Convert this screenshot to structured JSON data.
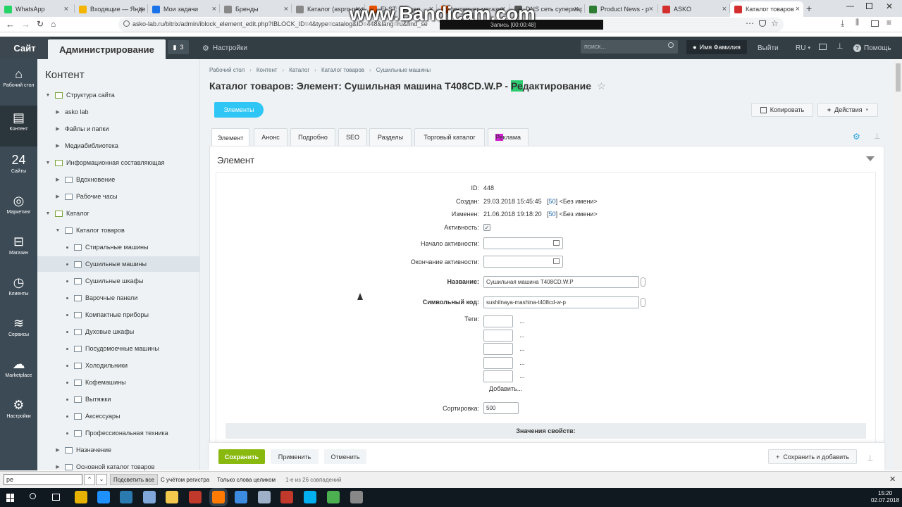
{
  "browser": {
    "tabs": [
      {
        "label": "WhatsApp",
        "color": "#25d366"
      },
      {
        "label": "Входящие — Янде",
        "color": "#f4b400"
      },
      {
        "label": "Мои задачи",
        "color": "#1a73e8"
      },
      {
        "label": "Бренды",
        "color": "#888888"
      },
      {
        "label": "Каталог (aspro.next)",
        "color": "#888888"
      },
      {
        "label": "ELST: Раздел",
        "color": "#e65100"
      },
      {
        "label": "интернет-магазин",
        "color": "#e65100"
      },
      {
        "label": "DNS сеть супермар",
        "color": "#555555"
      },
      {
        "label": "Product News - р",
        "color": "#2e7d32"
      },
      {
        "label": "ASKO",
        "color": "#d32f2f"
      },
      {
        "label": "Каталог товаров",
        "color": "#d32f2f"
      }
    ],
    "url": "asko-lab.ru/bitrix/admin/iblock_element_edit.php?IBLOCK_ID=4&type=catalog&ID=448&lang=ru&find_se"
  },
  "overlay": {
    "watermark": "www.Bandicam.com",
    "rec_label": "Запись [00:00:48]"
  },
  "adminbar": {
    "site": "Сайт",
    "admin": "Администрирование",
    "notif_count": "3",
    "settings": "Настройки",
    "search_placeholder": "поиск...",
    "user": "Имя Фамилия",
    "logout": "Выйти",
    "lang": "RU",
    "help": "Помощь"
  },
  "leftmenu": [
    {
      "label": "Рабочий стол",
      "icon": "home-icon"
    },
    {
      "label": "Контент",
      "icon": "document-icon"
    },
    {
      "label": "Сайты",
      "icon": "calendar-icon"
    },
    {
      "label": "Маркетинг",
      "icon": "target-icon"
    },
    {
      "label": "Магазин",
      "icon": "basket-icon"
    },
    {
      "label": "Клиенты",
      "icon": "clients-icon"
    },
    {
      "label": "Сервисы",
      "icon": "layers-icon"
    },
    {
      "label": "Marketplace",
      "icon": "cloud-icon"
    },
    {
      "label": "Настройки",
      "icon": "gear-icon"
    }
  ],
  "tree": {
    "title": "Контент",
    "items": [
      {
        "label": "Структура сайта",
        "level": 0,
        "type": "folder"
      },
      {
        "label": "asko lab",
        "level": 1,
        "type": "leaf"
      },
      {
        "label": "Файлы и папки",
        "level": 1,
        "type": "leaf"
      },
      {
        "label": "Медиабиблиотека",
        "level": 1,
        "type": "leaf"
      },
      {
        "label": "Информационная составляющая",
        "level": 0,
        "type": "folder"
      },
      {
        "label": "Вдохновение",
        "level": 1,
        "type": "folder"
      },
      {
        "label": "Рабочие часы",
        "level": 1,
        "type": "folder"
      },
      {
        "label": "Каталог",
        "level": 0,
        "type": "folder"
      },
      {
        "label": "Каталог товаров",
        "level": 1,
        "type": "folder"
      },
      {
        "label": "Стиральные машины",
        "level": 2,
        "type": "folder"
      },
      {
        "label": "Сушильные машины",
        "level": 2,
        "type": "folder"
      },
      {
        "label": "Сушильные шкафы",
        "level": 2,
        "type": "folder"
      },
      {
        "label": "Варочные панели",
        "level": 2,
        "type": "folder"
      },
      {
        "label": "Компактные приборы",
        "level": 2,
        "type": "folder"
      },
      {
        "label": "Духовые шкафы",
        "level": 2,
        "type": "folder"
      },
      {
        "label": "Посудомоечные машины",
        "level": 2,
        "type": "folder"
      },
      {
        "label": "Холодильники",
        "level": 2,
        "type": "folder"
      },
      {
        "label": "Кофемашины",
        "level": 2,
        "type": "folder"
      },
      {
        "label": "Вытяжки",
        "level": 2,
        "type": "folder"
      },
      {
        "label": "Аксессуары",
        "level": 2,
        "type": "folder"
      },
      {
        "label": "Профессиональная техника",
        "level": 2,
        "type": "folder"
      },
      {
        "label": "Назначение",
        "level": 1,
        "type": "folder"
      },
      {
        "label": "Основной каталог товаров",
        "level": 1,
        "type": "folder"
      }
    ]
  },
  "breadcrumbs": [
    "Рабочий стол",
    "Контент",
    "Каталог",
    "Каталог товаров",
    "Сушильные машины"
  ],
  "page": {
    "title_pre": "Каталог товаров: Элемент: Сушильная машина T408CD.W.P - ",
    "title_hl": "Ре",
    "title_post": "дактирование",
    "elements_btn": "Элементы",
    "copy_btn": "Копировать",
    "actions_btn": "Действия"
  },
  "tabs": [
    {
      "label": "Элемент"
    },
    {
      "label": "Анонс"
    },
    {
      "label": "Подробно"
    },
    {
      "label": "SEO"
    },
    {
      "label": "Разделы"
    },
    {
      "label": "Торговый каталог"
    },
    {
      "label_hl": "Ре",
      "label_rest": "клама"
    }
  ],
  "form": {
    "section_title": "Элемент",
    "id_label": "ID:",
    "id_value": "448",
    "created_label": "Создан:",
    "created_value": "29.03.2018 15:45:45",
    "created_user_id": "50",
    "created_user": "<Без имени>",
    "modified_label": "Изменен:",
    "modified_value": "21.06.2018 19:18:20",
    "modified_user_id": "50",
    "modified_user": "<Без имени>",
    "active_label": "Активность:",
    "active_checked": true,
    "active_from_label": "Начало активности:",
    "active_to_label": "Окончание активности:",
    "name_label": "Название:",
    "name_value": "Сушильная машина T408CD.W.P",
    "code_label": "Символьный код:",
    "code_value": "sushilnaya-mashina-t408cd-w-p",
    "tags_label": "Теги:",
    "tag_dots": "...",
    "add_label": "Добавить...",
    "sort_label": "Сортировка:",
    "sort_value": "500",
    "props_title": "Значения свойств:"
  },
  "actions": {
    "save": "Сохранить",
    "apply": "Применить",
    "cancel": "Отменить",
    "save_add": "Сохранить и добавить"
  },
  "findbar": {
    "query": "ре",
    "highlight_all": "Подсветить все",
    "match_case": "С учётом регистра",
    "whole_words": "Только слова целиком",
    "status": "1-е из 26 совпадений"
  },
  "clock": {
    "time": "15:20",
    "date": "02.07.2018"
  }
}
